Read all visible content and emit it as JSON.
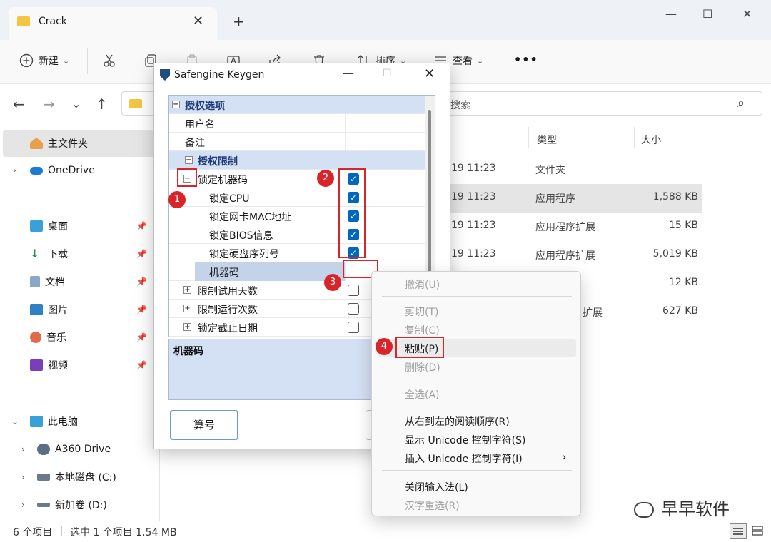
{
  "window": {
    "tab_title": "Crack",
    "tab_close": "✕",
    "new_tab": "+",
    "min": "—",
    "max": "☐",
    "close": "✕"
  },
  "toolbar": {
    "new_label": "新建",
    "sort_label": "排序",
    "view_label": "查看",
    "more": "•••",
    "chevron": "⌄"
  },
  "nav": {
    "back": "←",
    "forward": "→",
    "down": "⌄",
    "up": "↑",
    "search_placeholder": "搜索",
    "search_icon": "⌕"
  },
  "sidebar": {
    "items": [
      {
        "label": "主文件夹"
      },
      {
        "label": "OneDrive"
      },
      {
        "label": "桌面"
      },
      {
        "label": "下载"
      },
      {
        "label": "文档"
      },
      {
        "label": "图片"
      },
      {
        "label": "音乐"
      },
      {
        "label": "视频"
      },
      {
        "label": "此电脑"
      },
      {
        "label": "A360 Drive"
      },
      {
        "label": "本地磁盘 (C:)"
      },
      {
        "label": "新加卷 (D:)"
      }
    ]
  },
  "filelist": {
    "headers": {
      "type": "类型",
      "size": "大小"
    },
    "rows": [
      {
        "date": "19 11:23",
        "type": "文件夹",
        "size": ""
      },
      {
        "date": "19 11:23",
        "type": "应用程序",
        "size": "1,588 KB"
      },
      {
        "date": "19 11:23",
        "type": "应用程序扩展",
        "size": "15 KB"
      },
      {
        "date": "19 11:23",
        "type": "应用程序扩展",
        "size": "5,019 KB"
      },
      {
        "date": "",
        "type": "",
        "size": "12 KB"
      },
      {
        "date": "",
        "type": "扩展",
        "size": "627 KB"
      }
    ]
  },
  "status": {
    "count": "6 个项目",
    "selected": "选中 1 个项目  1.54 MB"
  },
  "keygen": {
    "title": "Safengine Keygen",
    "rows": [
      {
        "label": "授权选项"
      },
      {
        "label": "用户名"
      },
      {
        "label": "备注"
      },
      {
        "label": "授权限制"
      },
      {
        "label": "锁定机器码"
      },
      {
        "label": "锁定CPU"
      },
      {
        "label": "锁定网卡MAC地址"
      },
      {
        "label": "锁定BIOS信息"
      },
      {
        "label": "锁定硬盘序列号"
      },
      {
        "label": "机器码"
      },
      {
        "label": "限制试用天数"
      },
      {
        "label": "限制运行次数"
      },
      {
        "label": "锁定截止日期"
      }
    ],
    "desc_title": "机器码",
    "button": "算号"
  },
  "badges": [
    "1",
    "2",
    "3",
    "4"
  ],
  "context_menu": {
    "items": [
      {
        "label": "撤消(U)"
      },
      {
        "label": "剪切(T)"
      },
      {
        "label": "复制(C)"
      },
      {
        "label": "粘贴(P)"
      },
      {
        "label": "删除(D)"
      },
      {
        "label": "全选(A)"
      },
      {
        "label": "从右到左的阅读顺序(R)"
      },
      {
        "label": "显示 Unicode 控制字符(S)"
      },
      {
        "label": "插入 Unicode 控制字符(I)"
      },
      {
        "label": "关闭输入法(L)"
      },
      {
        "label": "汉字重选(R)"
      }
    ],
    "submenu_arrow": "›"
  },
  "watermark": "早早软件",
  "colors": {
    "accent": "#0067c0",
    "annotation": "#d9252a",
    "category_bg": "#d4e0f3"
  }
}
